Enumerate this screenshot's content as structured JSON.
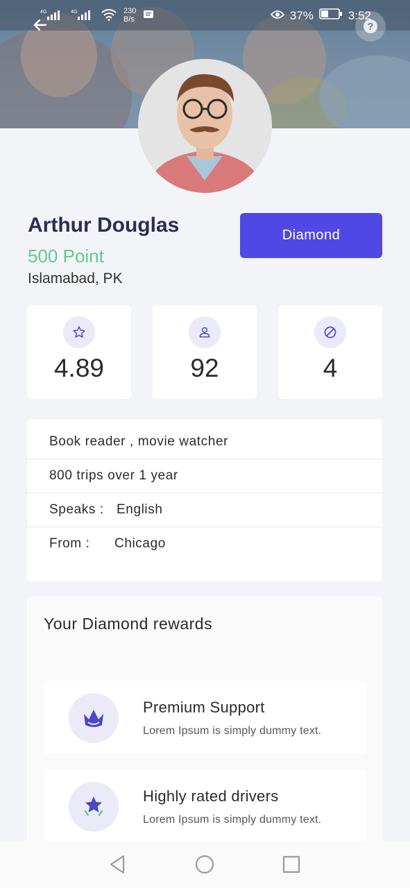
{
  "status_bar": {
    "network_1": "4G",
    "network_2": "4G",
    "data_speed_value": "230",
    "data_speed_unit": "B/s",
    "battery": "37%",
    "time": "3:52"
  },
  "profile": {
    "name": "Arthur Douglas",
    "points": "500 Point",
    "location": "Islamabad, PK",
    "tier_button": "Diamond"
  },
  "stats": [
    {
      "icon": "star-icon",
      "value": "4.89"
    },
    {
      "icon": "user-icon",
      "value": "92"
    },
    {
      "icon": "cancel-icon",
      "value": "4"
    }
  ],
  "info": {
    "hobbies": "Book reader , movie watcher",
    "trips": "800 trips over 1 year",
    "speaks_label": "Speaks :",
    "speaks_value": "English",
    "from_label": "From :",
    "from_value": "Chicago"
  },
  "rewards": {
    "title": "Your Diamond rewards",
    "items": [
      {
        "icon": "crown-lotus-icon",
        "title": "Premium Support",
        "description": "Lorem Ipsum is simply dummy text."
      },
      {
        "icon": "star-badge-icon",
        "title": "Highly rated drivers",
        "description": "Lorem Ipsum is simply dummy text."
      }
    ]
  },
  "colors": {
    "accent": "#5048e5",
    "points_green": "#5fca8b",
    "name_navy": "#2c2d55",
    "icon_bg": "#ebeaf9"
  }
}
